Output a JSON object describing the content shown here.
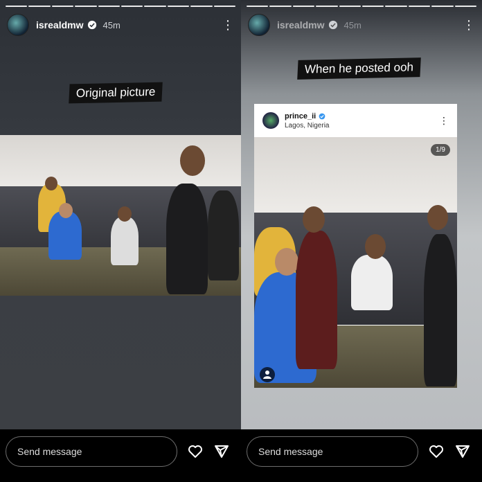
{
  "left": {
    "username": "isrealdmw",
    "time": "45m",
    "caption": "Original picture",
    "send_placeholder": "Send message"
  },
  "right": {
    "username": "isrealdmw",
    "time": "45m",
    "caption": "When he posted ooh",
    "post": {
      "username": "prince_ii",
      "location": "Lagos, Nigeria",
      "counter": "1/9"
    },
    "send_placeholder": "Send message"
  },
  "colors": {
    "accent": "#3897f0",
    "caption_bg": "#111111"
  },
  "icons": [
    "verified-icon",
    "more-icon",
    "heart-icon",
    "send-icon",
    "user-tag-icon"
  ]
}
